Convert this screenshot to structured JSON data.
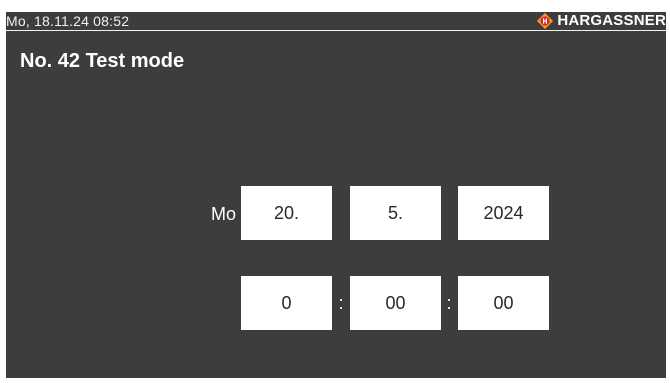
{
  "status_bar": {
    "datetime": "Mo, 18.11.24 08:52",
    "brand_name": "HARGASSNER",
    "brand_icon": "hargassner-logo-icon",
    "brand_color": "#f4a21a"
  },
  "page": {
    "title": "No. 42 Test mode"
  },
  "date_setting": {
    "weekday": "Mo",
    "day": "20.",
    "month": "5.",
    "year": "2024"
  },
  "time_setting": {
    "hour": "0",
    "minute": "00",
    "second": "00",
    "separator": ":"
  },
  "colors": {
    "background": "#3d3d3d",
    "text": "#ffffff",
    "field_background": "#ffffff",
    "field_text": "#2a2a2a"
  }
}
